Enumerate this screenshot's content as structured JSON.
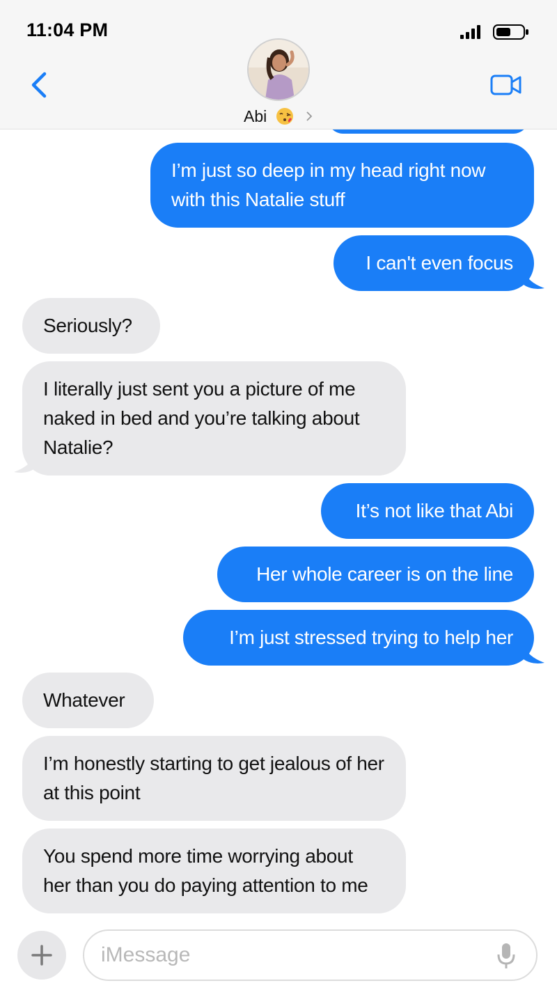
{
  "status_bar": {
    "time": "11:04 PM"
  },
  "header": {
    "contact_name": "Abi",
    "contact_emoji": "kissing-face-emoji",
    "back_icon": "chevron-left-icon",
    "video_icon": "video-camera-icon",
    "accent_color": "#1a7ef7"
  },
  "messages": [
    {
      "from": "me",
      "text": "I’m just so deep in my head right now with this Natalie stuff"
    },
    {
      "from": "me",
      "text": "I can't even focus"
    },
    {
      "from": "them",
      "text": "Seriously?"
    },
    {
      "from": "them",
      "text": "I literally just sent you a picture of me naked in bed and you’re talking about Natalie?"
    },
    {
      "from": "me",
      "text": "It’s not like that Abi"
    },
    {
      "from": "me",
      "text": "Her whole career is on the line"
    },
    {
      "from": "me",
      "text": "I’m just stressed trying to help her"
    },
    {
      "from": "them",
      "text": "Whatever"
    },
    {
      "from": "them",
      "text": "I’m honestly starting to get jealous of her at this point"
    },
    {
      "from": "them",
      "text": "You spend more time worrying about her than you do paying attention to me"
    }
  ],
  "composer": {
    "plus_icon": "plus-icon",
    "placeholder": "iMessage",
    "value": "",
    "mic_icon": "microphone-icon"
  },
  "colors": {
    "sent_bubble": "#1a7ef7",
    "received_bubble": "#e9e9eb",
    "header_bg": "#f6f6f6"
  }
}
